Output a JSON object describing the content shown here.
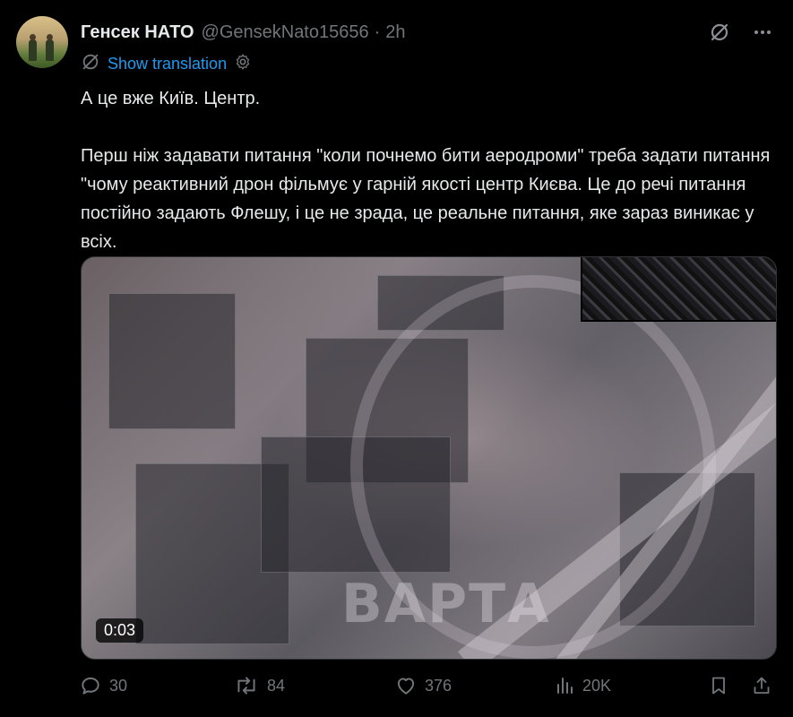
{
  "author": {
    "name": "Генсек НАТО",
    "handle": "@GensekNato15656",
    "separator": "·",
    "time": "2h"
  },
  "translation": {
    "label": "Show translation",
    "icon": "translate-icon",
    "settings_icon": "gear-icon"
  },
  "tweet": {
    "text": "А це вже Київ. Центр.\n\nПерш ніж задавати питання \"коли почнемо бити аеродроми\" треба задати питання \"чому реактивний дрон фільмує у гарній якості центр Києва. Це до речі питання постійно задають Флешу, і це не зрада, це реальне питання, яке зараз виникає у всіх."
  },
  "media": {
    "type": "video",
    "duration": "0:03",
    "watermark": "ВАРТА"
  },
  "actions": {
    "replies": "30",
    "reposts": "84",
    "likes": "376",
    "views": "20K"
  },
  "colors": {
    "background": "#000000",
    "text": "#e7e9ea",
    "muted": "#71767b",
    "accent": "#1d9bf0"
  }
}
